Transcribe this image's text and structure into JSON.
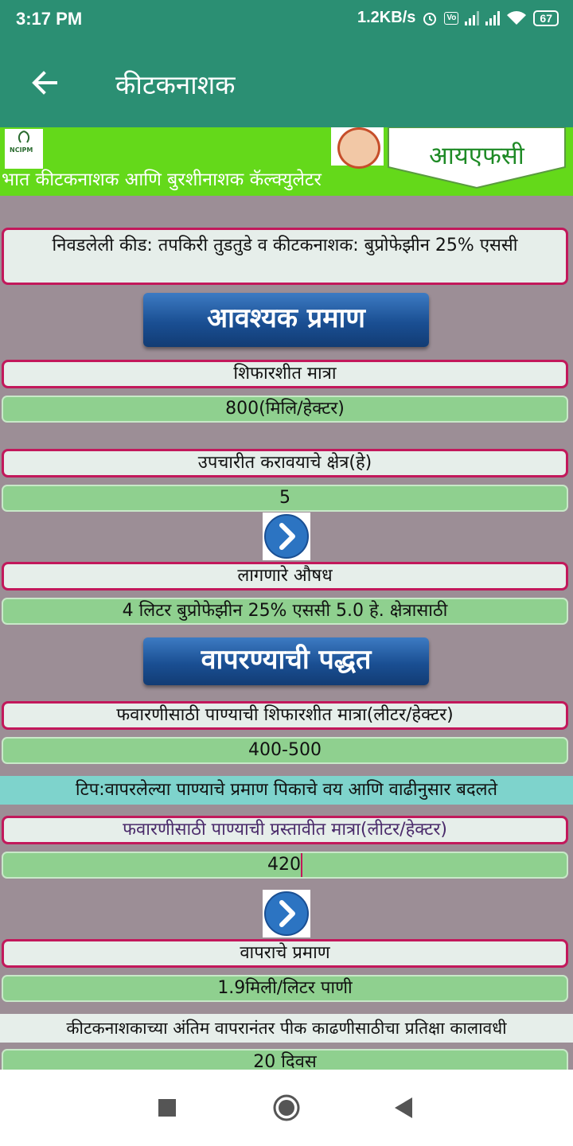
{
  "status": {
    "time": "3:17 PM",
    "speed": "1.2KB/s",
    "battery": "67"
  },
  "appbar": {
    "title": "कीटकनाशक",
    "back_icon": "arrow-left-icon"
  },
  "banner": {
    "logo_text": "NCIPM",
    "pennant_text": "आयएफसी",
    "subtitle": "भात कीटकनाशक आणि बुरशीनाशक कॅल्क्युलेटर"
  },
  "selection": "निवडलेली कीड: तपकिरी तुडतुडे  व कीटकनाशक:  बुप्रोफेझीन 25% एससी",
  "required_quantity_button": "आवश्यक प्रमाण",
  "recommended_dose": {
    "label": "शिफारशीत मात्रा",
    "value": "800(मिलि/हेक्टर)"
  },
  "area": {
    "label": "उपचारीत करावयाचे क्षेत्र(हे)",
    "value": "5"
  },
  "required_medicine": {
    "label": "लागणारे औषध",
    "value": "4 लिटर  बुप्रोफेझीन 25% एससी  5.0 हे. क्षेत्रासाठी"
  },
  "method_button": "वापरण्याची पद्धत",
  "water_recommended": {
    "label": "फवारणीसाठी पाण्याची शिफारशीत मात्रा(लीटर/हेक्टर)",
    "value": "400-500"
  },
  "tip": "टिप:वापरलेल्या पाण्याचे प्रमाण पिकाचे वय आणि वाढीनुसार बदलते",
  "water_proposed": {
    "label": "फवारणीसाठी पाण्याची प्रस्तावीत मात्रा(लीटर/हेक्टर)",
    "value": "420"
  },
  "usage": {
    "label": "वापराचे प्रमाण",
    "value": "1.9मिली/लिटर पाणी"
  },
  "waiting_period": {
    "label": "कीटकनाशकाच्या अंतिम वापरानंतर पीक काढणीसाठीचा प्रतिक्षा कालावधी",
    "value": "20 दिवस"
  },
  "colors": {
    "primary": "#2b8f73",
    "banner": "#64d91a",
    "label_border": "#c2185b",
    "value_bg": "#8fd08f",
    "button": "#1a4f93",
    "tip_bg": "#7ed3cc"
  }
}
